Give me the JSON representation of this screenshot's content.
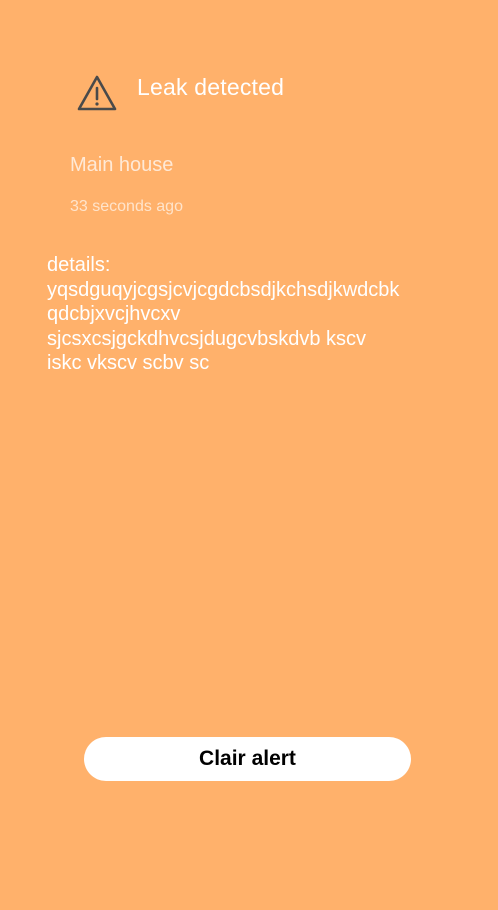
{
  "alert": {
    "title": "Leak detected",
    "icon": "warning-triangle-icon",
    "location": "Main house",
    "time_ago": "33 seconds ago"
  },
  "details": {
    "lines": [
      "details:",
      "yqsdguqyjcgsjcvjcgdcbsdjkchsdjkwdcbk",
      "qdcbjxvcjhvcxv",
      "sjcsxcsjgckdhvcsjdugcvbskdvb kscv",
      "iskc vkscv scbv sc"
    ]
  },
  "actions": {
    "clear_label": "Clair alert"
  },
  "colors": {
    "background": "#FFB16B",
    "text": "#FFFFFF",
    "icon": "#4A4A4A",
    "button_bg": "#FFFFFF",
    "button_text": "#000000"
  }
}
